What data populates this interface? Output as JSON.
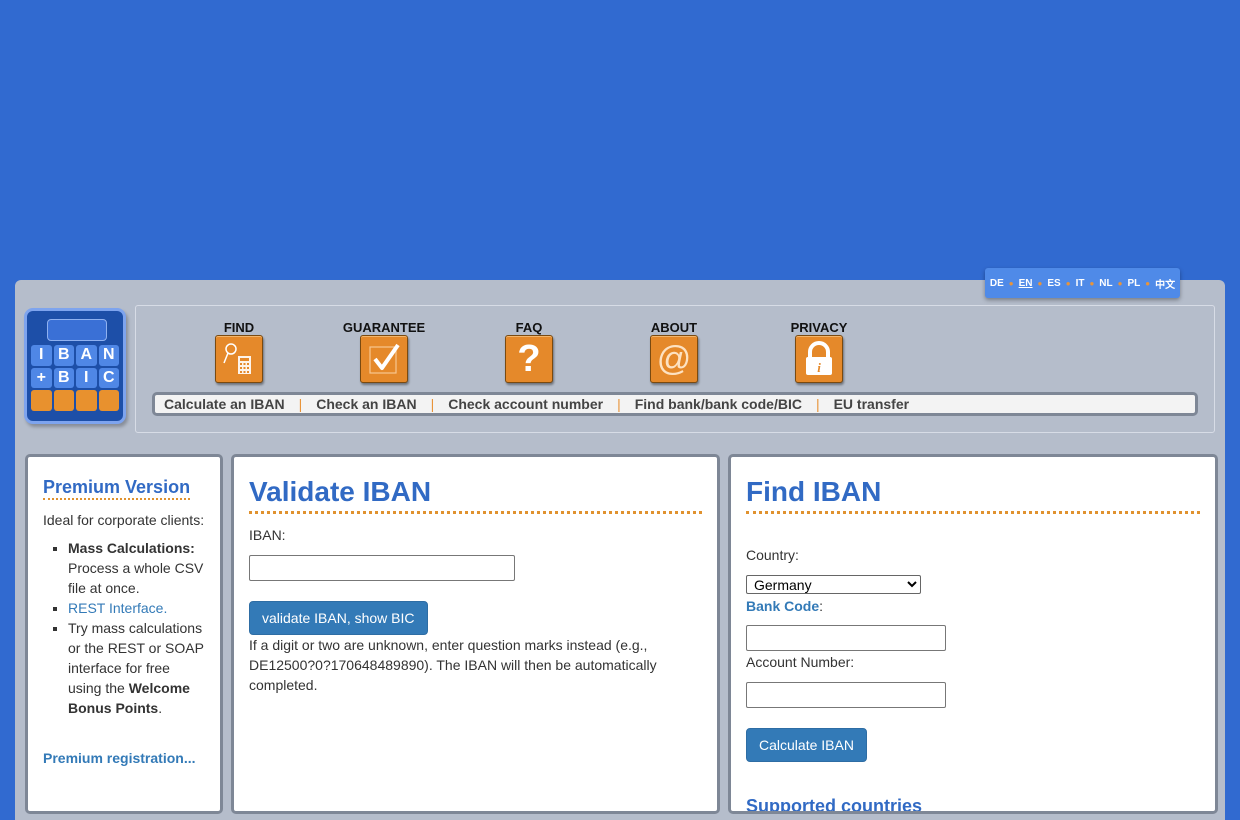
{
  "languages": [
    {
      "code": "DE",
      "active": false
    },
    {
      "code": "EN",
      "active": true
    },
    {
      "code": "ES",
      "active": false
    },
    {
      "code": "IT",
      "active": false
    },
    {
      "code": "NL",
      "active": false
    },
    {
      "code": "PL",
      "active": false
    },
    {
      "code": "中文",
      "active": false
    }
  ],
  "logo": {
    "row1": [
      "I",
      "B",
      "A",
      "N"
    ],
    "row2": [
      "+",
      "B",
      "I",
      "C"
    ]
  },
  "nav_icons": [
    {
      "label": "FIND",
      "icon": "find-calculator-icon"
    },
    {
      "label": "GUARANTEE",
      "icon": "checkmark-icon"
    },
    {
      "label": "FAQ",
      "icon": "question-mark-icon"
    },
    {
      "label": "ABOUT",
      "icon": "at-sign-icon"
    },
    {
      "label": "PRIVACY",
      "icon": "padlock-info-icon"
    }
  ],
  "subnav": [
    "Calculate an IBAN",
    "Check an IBAN",
    "Check account number",
    "Find bank/bank code/BIC",
    "EU transfer"
  ],
  "premium": {
    "title": "Premium Version",
    "intro": "Ideal for corporate clients:",
    "item1_bold": "Mass Calculations:",
    "item1_text": "Process a whole CSV file at once.",
    "item2_link": "REST Interface.",
    "item3_text": "Try mass calculations or the REST or SOAP interface for free using the ",
    "item3_bold": "Welcome Bonus Points",
    "item3_end": ".",
    "registration_link": "Premium registration..."
  },
  "validate": {
    "title": "Validate IBAN",
    "iban_label": "IBAN:",
    "iban_value": "",
    "button": "validate IBAN, show BIC",
    "hint": "If a digit or two are unknown, enter question marks instead (e.g., DE12500?0?170648489890). The IBAN will then be automatically completed."
  },
  "find": {
    "title": "Find IBAN",
    "country_label": "Country:",
    "country_selected": "Germany",
    "bank_code_label": "Bank Code",
    "bank_code_value": "",
    "account_label": "Account Number:",
    "account_value": "",
    "button": "Calculate IBAN",
    "next_heading": "Supported countries"
  }
}
